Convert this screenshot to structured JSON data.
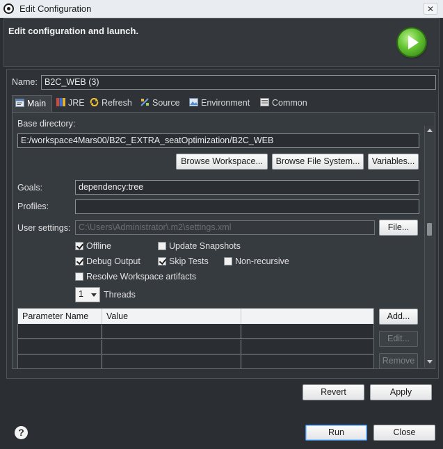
{
  "window": {
    "title": "Edit Configuration",
    "close_glyph": "✕"
  },
  "banner": {
    "heading": "Edit configuration and launch.",
    "icon": "run-icon"
  },
  "name": {
    "label": "Name:",
    "value": "B2C_WEB (3)"
  },
  "tabs": [
    {
      "label": "Main",
      "icon": "main-icon",
      "active": true
    },
    {
      "label": "JRE",
      "icon": "jre-icon",
      "active": false
    },
    {
      "label": "Refresh",
      "icon": "refresh-icon",
      "active": false
    },
    {
      "label": "Source",
      "icon": "source-icon",
      "active": false
    },
    {
      "label": "Environment",
      "icon": "environment-icon",
      "active": false
    },
    {
      "label": "Common",
      "icon": "common-icon",
      "active": false
    }
  ],
  "main": {
    "base_dir_label": "Base directory:",
    "base_dir_value": "E:/workspace4Mars00/B2C_EXTRA_seatOptimization/B2C_WEB",
    "browse_workspace": "Browse Workspace...",
    "browse_fs": "Browse File System...",
    "variables": "Variables...",
    "goals_label": "Goals:",
    "goals_value": "dependency:tree",
    "profiles_label": "Profiles:",
    "profiles_value": "",
    "user_settings_label": "User settings:",
    "user_settings_value": "C:\\Users\\Administrator\\.m2\\settings.xml",
    "file_button": "File...",
    "options": {
      "offline": {
        "label": "Offline",
        "checked": true
      },
      "update_snapshots": {
        "label": "Update Snapshots",
        "checked": false
      },
      "debug_output": {
        "label": "Debug Output",
        "checked": true
      },
      "skip_tests": {
        "label": "Skip Tests",
        "checked": true
      },
      "non_recursive": {
        "label": "Non-recursive",
        "checked": false
      },
      "resolve_workspace": {
        "label": "Resolve Workspace artifacts",
        "checked": false
      }
    },
    "threads_value": "1",
    "threads_label": "Threads",
    "table": {
      "columns": [
        "Parameter Name",
        "Value",
        ""
      ],
      "rows": [
        [
          "",
          "",
          ""
        ],
        [
          "",
          "",
          ""
        ],
        [
          "",
          "",
          ""
        ]
      ]
    },
    "add_button": "Add...",
    "edit_button": "Edit...",
    "remove_button": "Remove"
  },
  "footer": {
    "revert": "Revert",
    "apply": "Apply",
    "run": "Run",
    "close": "Close",
    "help_glyph": "?"
  }
}
